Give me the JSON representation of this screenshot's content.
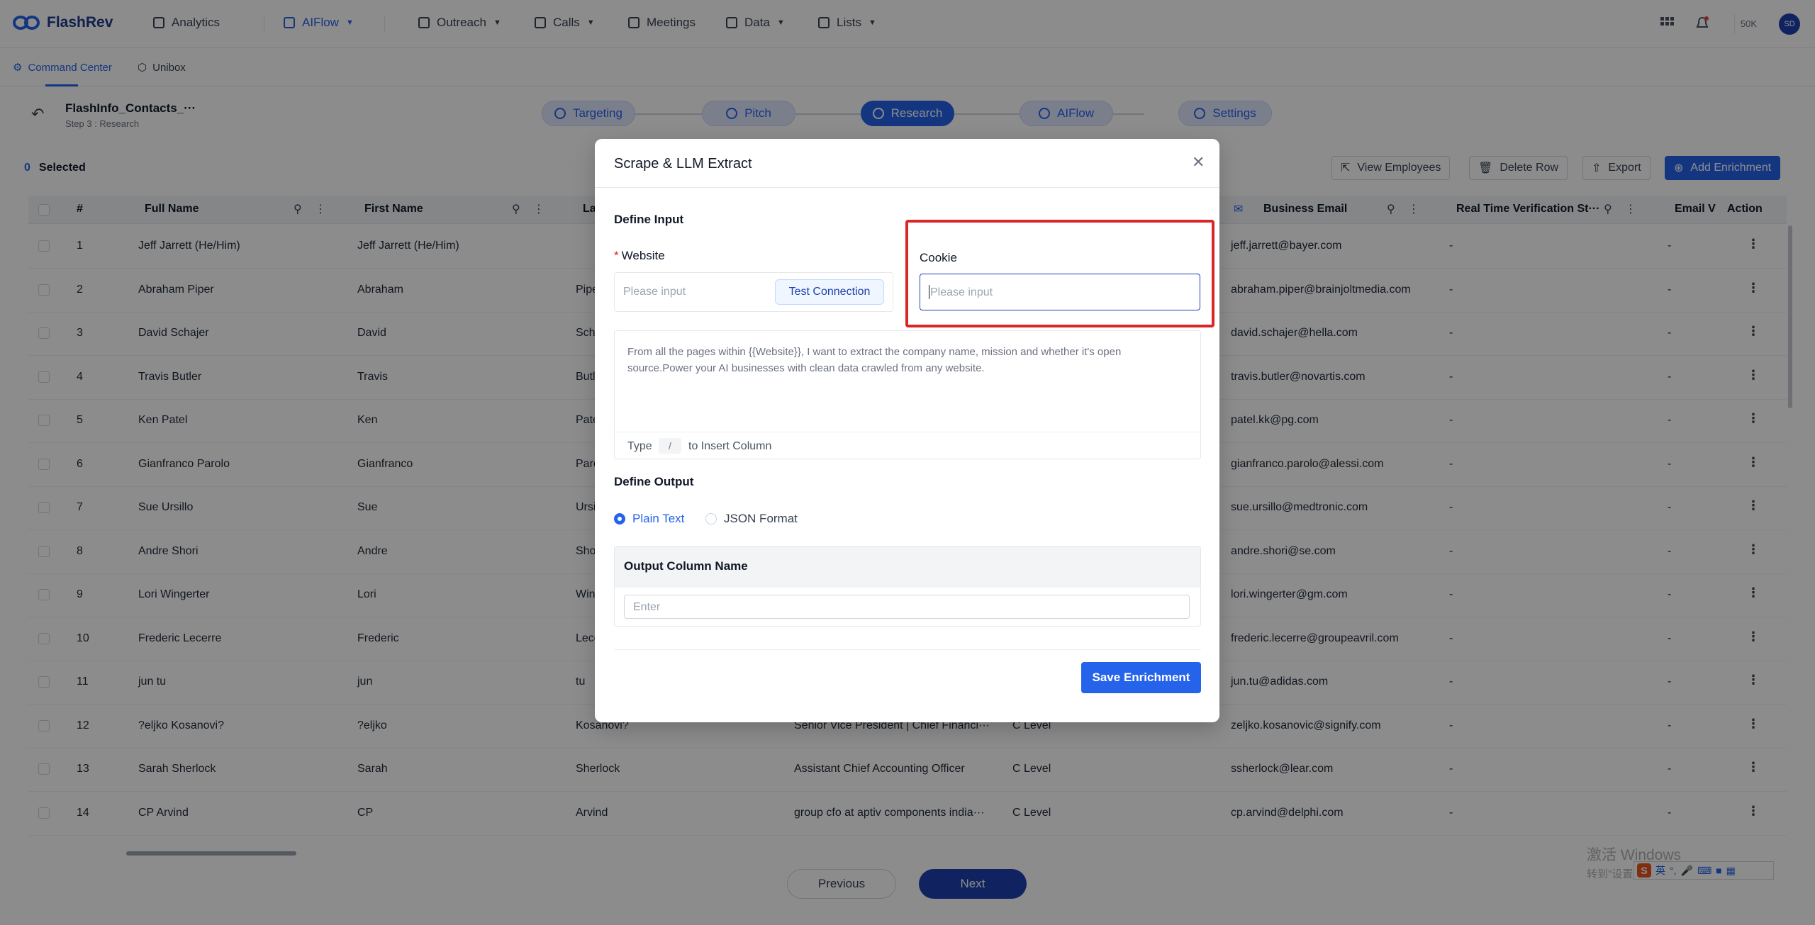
{
  "app": {
    "logo_text": "FlashRev"
  },
  "topnav": {
    "items": [
      {
        "label": "Analytics",
        "icon": "analytics-icon"
      },
      {
        "label": "AIFlow",
        "icon": "aiflow-icon",
        "active": true
      },
      {
        "label": "Outreach",
        "icon": "outreach-icon"
      },
      {
        "label": "Calls",
        "icon": "phone-icon"
      },
      {
        "label": "Meetings",
        "icon": "meetings-icon"
      },
      {
        "label": "Data",
        "icon": "database-icon"
      },
      {
        "label": "Lists",
        "icon": "list-icon"
      }
    ],
    "credits": "50K",
    "avatar": "SD"
  },
  "subnav": {
    "tabs": [
      {
        "label": "Command Center",
        "active": true
      },
      {
        "label": "Unibox"
      }
    ]
  },
  "project": {
    "title": "FlashInfo_Contacts_···",
    "step": "Step 3 : Research"
  },
  "stepper": [
    {
      "label": "Targeting"
    },
    {
      "label": "Pitch"
    },
    {
      "label": "Research",
      "active": true
    },
    {
      "label": "AIFlow"
    },
    {
      "label": "Settings"
    }
  ],
  "toolbar": {
    "selected_count": "0",
    "selected_label": "Selected",
    "view_employees": "View Employees",
    "delete_row": "Delete Row",
    "export": "Export",
    "add_enrichment": "Add Enrichment"
  },
  "table": {
    "headers": {
      "num": "#",
      "full_name": "Full Name",
      "first_name": "First Name",
      "last_name": "La",
      "business_email": "Business Email",
      "verification": "Real Time Verification St···",
      "email_v": "Email V",
      "action": "Action"
    },
    "rows": [
      {
        "n": "1",
        "full": "Jeff Jarrett (He/Him)",
        "first": "Jeff Jarrett (He/Him)",
        "last": "",
        "title": "",
        "level": "",
        "email": "jeff.jarrett@bayer.com",
        "verif": "-",
        "ev": "-"
      },
      {
        "n": "2",
        "full": "Abraham Piper",
        "first": "Abraham",
        "last": "Pipe",
        "title": "",
        "level": "",
        "email": "abraham.piper@brainjoltmedia.com",
        "verif": "-",
        "ev": "-"
      },
      {
        "n": "3",
        "full": "David Schajer",
        "first": "David",
        "last": "Scha",
        "title": "",
        "level": "",
        "email": "david.schajer@hella.com",
        "verif": "-",
        "ev": "-"
      },
      {
        "n": "4",
        "full": "Travis Butler",
        "first": "Travis",
        "last": "Butl",
        "title": "",
        "level": "",
        "email": "travis.butler@novartis.com",
        "verif": "-",
        "ev": "-"
      },
      {
        "n": "5",
        "full": "Ken Patel",
        "first": "Ken",
        "last": "Pate",
        "title": "",
        "level": "",
        "email": "patel.kk@pg.com",
        "verif": "-",
        "ev": "-"
      },
      {
        "n": "6",
        "full": "Gianfranco Parolo",
        "first": "Gianfranco",
        "last": "Paro",
        "title": "",
        "level": "",
        "email": "gianfranco.parolo@alessi.com",
        "verif": "-",
        "ev": "-"
      },
      {
        "n": "7",
        "full": "Sue Ursillo",
        "first": "Sue",
        "last": "Ursi",
        "title": "",
        "level": "",
        "email": "sue.ursillo@medtronic.com",
        "verif": "-",
        "ev": "-"
      },
      {
        "n": "8",
        "full": "Andre Shori",
        "first": "Andre",
        "last": "Sho",
        "title": "",
        "level": "",
        "email": "andre.shori@se.com",
        "verif": "-",
        "ev": "-"
      },
      {
        "n": "9",
        "full": "Lori Wingerter",
        "first": "Lori",
        "last": "Win",
        "title": "",
        "level": "",
        "email": "lori.wingerter@gm.com",
        "verif": "-",
        "ev": "-"
      },
      {
        "n": "10",
        "full": "Frederic Lecerre",
        "first": "Frederic",
        "last": "Lece",
        "title": "",
        "level": "",
        "email": "frederic.lecerre@groupeavril.com",
        "verif": "-",
        "ev": "-"
      },
      {
        "n": "11",
        "full": "jun tu",
        "first": "jun",
        "last": "tu",
        "title": "",
        "level": "",
        "email": "jun.tu@adidas.com",
        "verif": "-",
        "ev": "-"
      },
      {
        "n": "12",
        "full": "?eljko Kosanovi?",
        "first": "?eljko",
        "last": "Kosanovi?",
        "title": "Senior Vice President | Chief Financi···",
        "level": "C Level",
        "email": "zeljko.kosanovic@signify.com",
        "verif": "-",
        "ev": "-"
      },
      {
        "n": "13",
        "full": "Sarah Sherlock",
        "first": "Sarah",
        "last": "Sherlock",
        "title": "Assistant Chief Accounting Officer",
        "level": "C Level",
        "email": "ssherlock@lear.com",
        "verif": "-",
        "ev": "-"
      },
      {
        "n": "14",
        "full": "CP Arvind",
        "first": "CP",
        "last": "Arvind",
        "title": "group cfo at aptiv components india···",
        "level": "C Level",
        "email": "cp.arvind@delphi.com",
        "verif": "-",
        "ev": "-"
      }
    ]
  },
  "pagination": {
    "previous": "Previous",
    "next": "Next"
  },
  "modal": {
    "title": "Scrape & LLM Extract",
    "define_input": "Define Input",
    "website_label": "Website",
    "website_required": "*",
    "website_placeholder": "Please input",
    "test_connection": "Test Connection",
    "cookie_label": "Cookie",
    "cookie_placeholder": "Please input",
    "prompt_text": "From all the pages within {{Website}}, I want to extract the company name, mission and whether it's open source.Power your AI businesses with clean data crawled from any website.",
    "insert_type": "Type",
    "insert_key": "/",
    "insert_rest": "to Insert Column",
    "define_output": "Define Output",
    "output_formats": [
      {
        "label": "Plain Text",
        "selected": true
      },
      {
        "label": "JSON Format",
        "selected": false
      }
    ],
    "output_column_name": "Output Column Name",
    "output_placeholder": "Enter",
    "save": "Save Enrichment"
  },
  "watermark": {
    "line1": "激活 Windows",
    "line2": "转到\"设置\"以激活 Windows。"
  },
  "ime": {
    "logo": "S",
    "lang": "英"
  },
  "colors": {
    "accent": "#2563eb",
    "highlight_frame": "#dc2626",
    "overlay": "rgba(0,0,0,0.45)"
  }
}
